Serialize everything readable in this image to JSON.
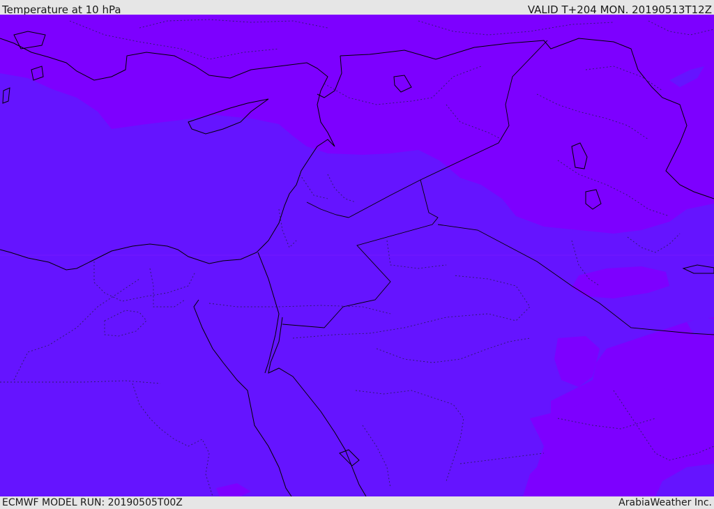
{
  "header": {
    "title": "Temperature at 10 hPa",
    "valid_time": "VALID T+204 MON. 20190513T12Z"
  },
  "footer": {
    "model_run": "ECMWF MODEL RUN: 20190505T00Z",
    "credit": "ArabiaWeather Inc."
  },
  "colors": {
    "field_warm": "#7d00ff",
    "field_cool": "#6514ff",
    "field_mid": "#6f0aff",
    "coastline": "#000000",
    "border_dotted": "#2a1a66"
  }
}
